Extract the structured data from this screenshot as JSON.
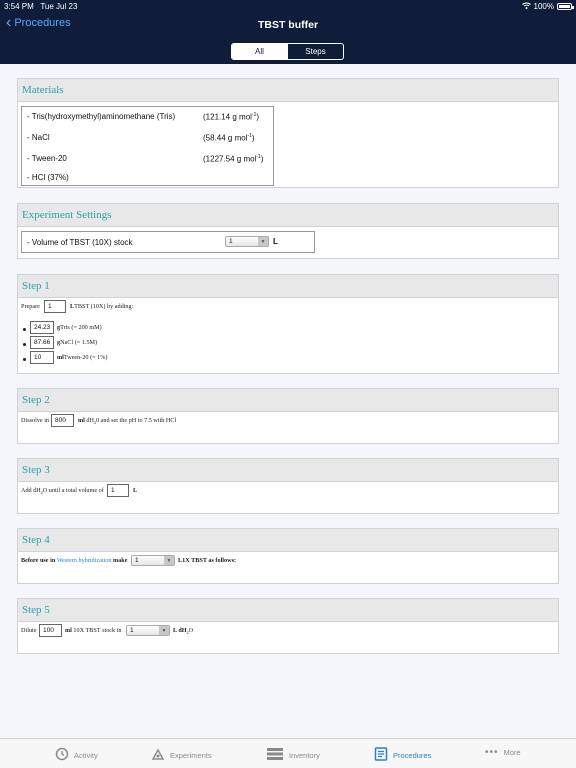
{
  "status": {
    "time": "3:54 PM",
    "date": "Tue Jul 23",
    "battery": "100%"
  },
  "nav": {
    "back_label": "Procedures",
    "title": "TBST buffer"
  },
  "segment": {
    "all": "All",
    "steps": "Steps",
    "selected": "All"
  },
  "materials": {
    "heading": "Materials",
    "items": [
      {
        "name": "- Tris(hydroxymethyl)aminomethane (Tris)",
        "mw": "(121.14 g mol",
        "sup": "-1",
        "close": ")"
      },
      {
        "name": "- NaCl",
        "mw": "(58.44 g mol",
        "sup": "-1",
        "close": ")"
      },
      {
        "name": "- Tween-20",
        "mw": "(1227.54 g mol",
        "sup": "-1",
        "close": ")"
      },
      {
        "name": "- HCl (37%)",
        "mw": "",
        "sup": "",
        "close": ""
      }
    ]
  },
  "settings": {
    "heading": "Experiment Settings",
    "label": "- Volume of TBST (10X) stock",
    "value": "1",
    "unit": "L"
  },
  "step1": {
    "heading": "Step 1",
    "prefix": "Prepare",
    "volume": "1",
    "unit": "L",
    "suffix": "TBST (10X) by adding:",
    "rows": [
      {
        "value": "24.23",
        "unit": "g",
        "text": "Tris (= 200 mM)"
      },
      {
        "value": "87.66",
        "unit": "g",
        "text": "NaCl (= 1.5M)"
      },
      {
        "value": "10",
        "unit": "ml",
        "text": "Tween-20 (= 1%)"
      }
    ]
  },
  "step2": {
    "heading": "Step 2",
    "prefix": "Dissolve in",
    "value": "800",
    "unit": "ml",
    "text_a": "dH",
    "sub": "2",
    "text_b": "0 and set the pH to 7.5 with HCl"
  },
  "step3": {
    "heading": "Step 3",
    "text_a": "Add dH",
    "sub": "2",
    "text_b": "O until a total volume of",
    "value": "1",
    "unit": "L"
  },
  "step4": {
    "heading": "Step 4",
    "prefix": "Before use in",
    "link": "Western hybridization",
    "mid": "make",
    "value": "1",
    "suffix": "L1X TBST as follows:"
  },
  "step5": {
    "heading": "Step 5",
    "prefix": "Dilute",
    "value": "100",
    "unit": "ml",
    "mid": "10X TBST stock in",
    "dd_value": "1",
    "suffix_a": "L dH",
    "sub": "2",
    "suffix_b": "O"
  },
  "tabs": [
    {
      "label": "Activity",
      "icon": "activity-icon",
      "active": false
    },
    {
      "label": "Experiments",
      "icon": "experiments-icon",
      "active": false
    },
    {
      "label": "Inventory",
      "icon": "inventory-icon",
      "active": false
    },
    {
      "label": "Procedures",
      "icon": "procedures-icon",
      "active": true
    },
    {
      "label": "More",
      "icon": "more-icon",
      "active": false
    }
  ],
  "colors": {
    "nav_bg": "#0f1d3b",
    "accent": "#2aa1a8",
    "link": "#2a7fd4"
  }
}
